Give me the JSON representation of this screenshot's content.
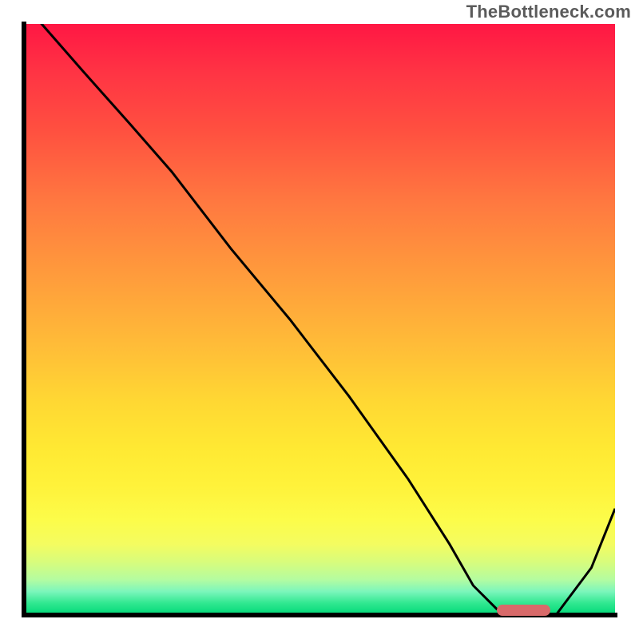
{
  "chart_data": {
    "type": "line",
    "title": "",
    "xlabel": "",
    "ylabel": "",
    "xlim": [
      0,
      100
    ],
    "ylim": [
      0,
      100
    ],
    "x": [
      0,
      3,
      10,
      18,
      25,
      35,
      45,
      55,
      65,
      72,
      76,
      80,
      84,
      90,
      96,
      100
    ],
    "values": [
      104,
      100,
      92,
      83,
      75,
      62,
      50,
      37,
      23,
      12,
      5,
      1,
      0,
      0,
      8,
      18
    ],
    "optimal_marker": {
      "x_start": 80,
      "x_end": 89,
      "y": 0.8
    },
    "watermark": "TheBottleneck.com",
    "gradient_stops": [
      {
        "pos": 0,
        "color": "#ff1744"
      },
      {
        "pos": 50,
        "color": "#ffbb38"
      },
      {
        "pos": 80,
        "color": "#fff23a"
      },
      {
        "pos": 100,
        "color": "#00d878"
      }
    ]
  }
}
